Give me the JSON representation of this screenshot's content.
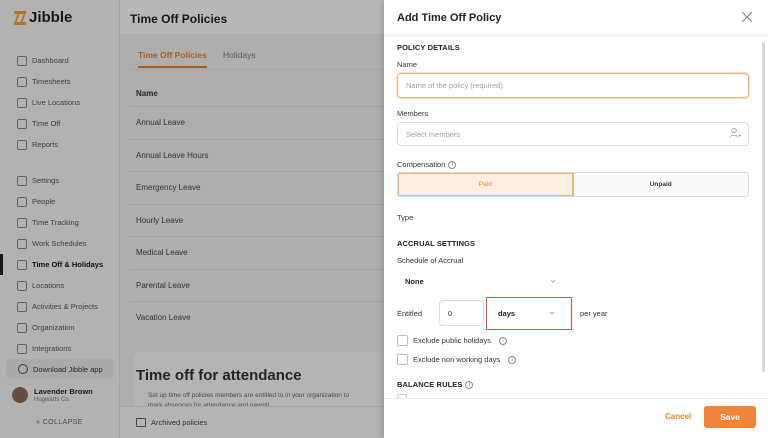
{
  "app": {
    "logo_text": "Jibble",
    "page_title": "Time Off Policies"
  },
  "sidebar": {
    "items_top": [
      {
        "label": "Dashboard",
        "icon": "dashboard-icon"
      },
      {
        "label": "Timesheets",
        "icon": "clock-icon"
      },
      {
        "label": "Live Locations",
        "icon": "location-icon"
      },
      {
        "label": "Time Off",
        "icon": "calendar-icon"
      },
      {
        "label": "Reports",
        "icon": "reports-icon"
      }
    ],
    "items_bottom": [
      {
        "label": "Settings",
        "icon": "settings-icon"
      },
      {
        "label": "People",
        "icon": "people-icon"
      },
      {
        "label": "Time Tracking",
        "icon": "time-tracking-icon"
      },
      {
        "label": "Work Schedules",
        "icon": "schedule-icon"
      },
      {
        "label": "Time Off & Holidays",
        "icon": "time-off-icon",
        "active": true
      },
      {
        "label": "Locations",
        "icon": "map-pin-icon"
      },
      {
        "label": "Activities & Projects",
        "icon": "activities-icon"
      },
      {
        "label": "Organization",
        "icon": "organization-icon"
      },
      {
        "label": "Integrations",
        "icon": "integrations-icon"
      }
    ],
    "download_label": "Download Jibble app",
    "user_name": "Lavender Brown",
    "user_org": "Hogwarts Co.",
    "collapse_label": "COLLAPSE"
  },
  "main": {
    "tabs": [
      "Time Off Policies",
      "Holidays"
    ],
    "list_header": "Name",
    "policies": [
      "Annual Leave",
      "Annual Leave Hours",
      "Emergency Leave",
      "Hourly Leave",
      "Medical Leave",
      "Parental Leave",
      "Vacation Leave"
    ],
    "attendance_title": "Time off for attendance",
    "attendance_text": "Set up time off policies members are entitled to in your organization to mark absences for attendance and payroll",
    "archived_label": "Archived policies"
  },
  "drawer": {
    "title": "Add Time Off Policy",
    "policy_details": "POLICY DETAILS",
    "name_label": "Name",
    "name_placeholder": "Name of the policy (required)",
    "members_label": "Members",
    "members_placeholder": "Select members",
    "compensation_label": "Compensation",
    "paid_label": "Paid",
    "unpaid_label": "Unpaid",
    "type_label": "Type",
    "accrual_settings": "ACCRUAL SETTINGS",
    "schedule_label": "Schedule of Accrual",
    "schedule_value": "None",
    "entitled_label": "Entitled",
    "entitled_value": "0",
    "unit_value": "days",
    "per_year": "per year",
    "exclude_holidays": "Exclude public holidays",
    "exclude_non_working": "Exclude non working days",
    "balance_rules": "BALANCE RULES",
    "cancel_label": "Cancel",
    "save_label": "Save"
  },
  "colors": {
    "accent": "#f0843a",
    "highlight": "#e04a4a"
  }
}
